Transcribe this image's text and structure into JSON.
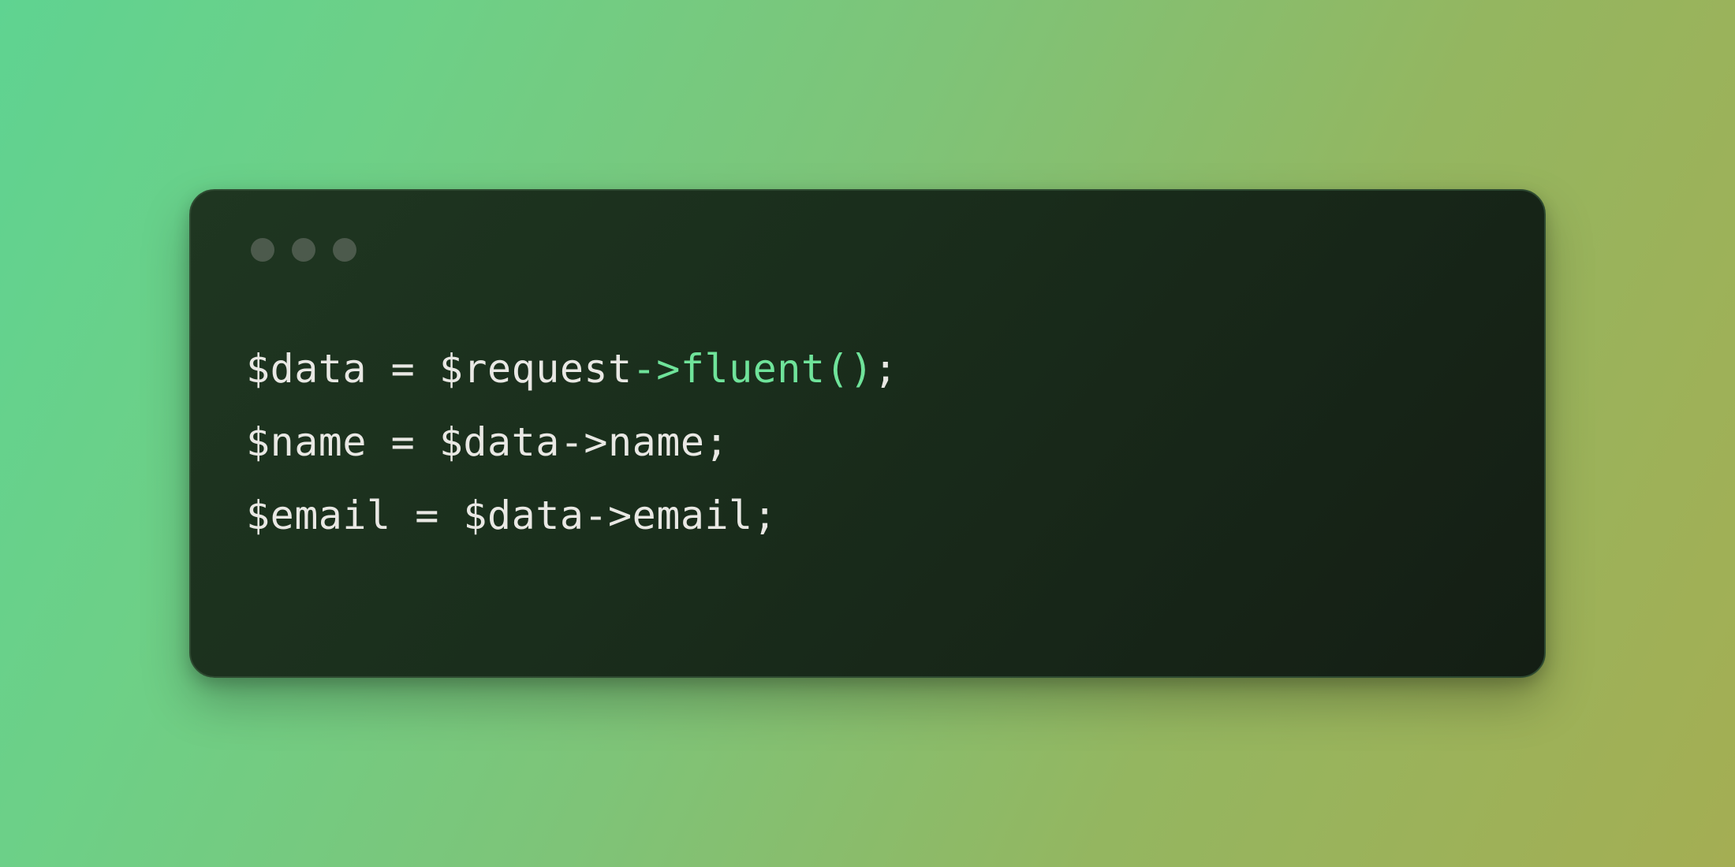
{
  "colors": {
    "text_default": "#e9e8e4",
    "text_highlight": "#6fe39a",
    "window_bg_start": "#1f3621",
    "window_bg_end": "#141e14"
  },
  "code": {
    "lines": [
      [
        {
          "t": "$data = $request",
          "c": "default"
        },
        {
          "t": "->",
          "c": "green"
        },
        {
          "t": "fluent",
          "c": "green"
        },
        {
          "t": "()",
          "c": "green"
        },
        {
          "t": ";",
          "c": "default"
        }
      ],
      [
        {
          "t": "$name = $data->name;",
          "c": "default"
        }
      ],
      [
        {
          "t": "$email = $data->email;",
          "c": "default"
        }
      ]
    ]
  }
}
